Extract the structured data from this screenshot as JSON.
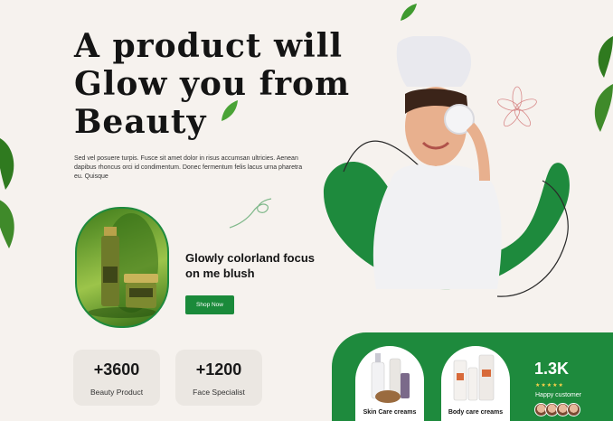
{
  "hero": {
    "title_lines": [
      "A product will",
      "Glow you from",
      "Beauty"
    ],
    "description": "Sed vel posuere turpis. Fusce sit amet dolor in risus accumsan ultricies. Aenean dapibus rhoncus orci id condimentum. Donec fermentum felis lacus urna pharetra eu. Quisque"
  },
  "feature": {
    "title": "Glowly colorland focus on me blush",
    "button_label": "Shop Now"
  },
  "stats": [
    {
      "value": "+3600",
      "label": "Beauty Product"
    },
    {
      "value": "+1200",
      "label": "Face Specialist"
    }
  ],
  "categories": [
    {
      "label": "Skin Care creams"
    },
    {
      "label": "Body care creams"
    }
  ],
  "happy": {
    "count": "1.3K",
    "stars": "★★★★★",
    "label": "Happy customer"
  },
  "colors": {
    "accent": "#1e8a3d",
    "background": "#f6f2ee",
    "card": "#ebe7e2"
  },
  "icons": [
    "leaf-icon",
    "flower-icon",
    "star-icon",
    "avatar-icon"
  ]
}
